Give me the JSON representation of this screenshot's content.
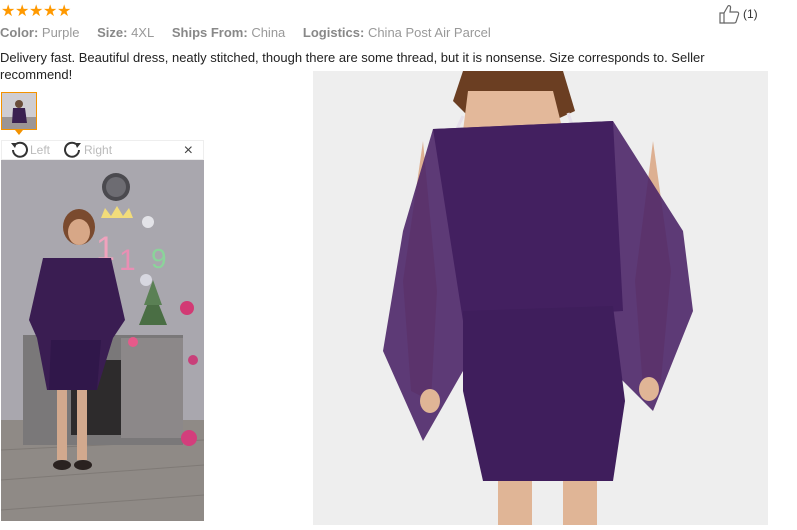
{
  "review": {
    "rating": 5,
    "attributes": [
      {
        "key": "Color:",
        "value": "Purple"
      },
      {
        "key": "Size:",
        "value": "4XL"
      },
      {
        "key": "Ships From:",
        "value": "China"
      },
      {
        "key": "Logistics:",
        "value": "China Post Air Parcel"
      }
    ],
    "helpful_count": "(1)",
    "text": "Delivery fast. Beautiful dress, neatly stitched, though there are some thread, but it is nonsense. Size corresponds to. Seller recommend!"
  },
  "viewer": {
    "rotate_left_label": "Left",
    "rotate_right_label": "Right",
    "close_label": "×"
  },
  "colors": {
    "star": "#ff9900",
    "accent_border": "#f39200",
    "dress": "#4a2566"
  },
  "icons": {
    "star": "star-icon",
    "helpful": "thumbs-up-icon",
    "rotate_left": "rotate-left-icon",
    "rotate_right": "rotate-right-icon",
    "close": "close-icon"
  }
}
